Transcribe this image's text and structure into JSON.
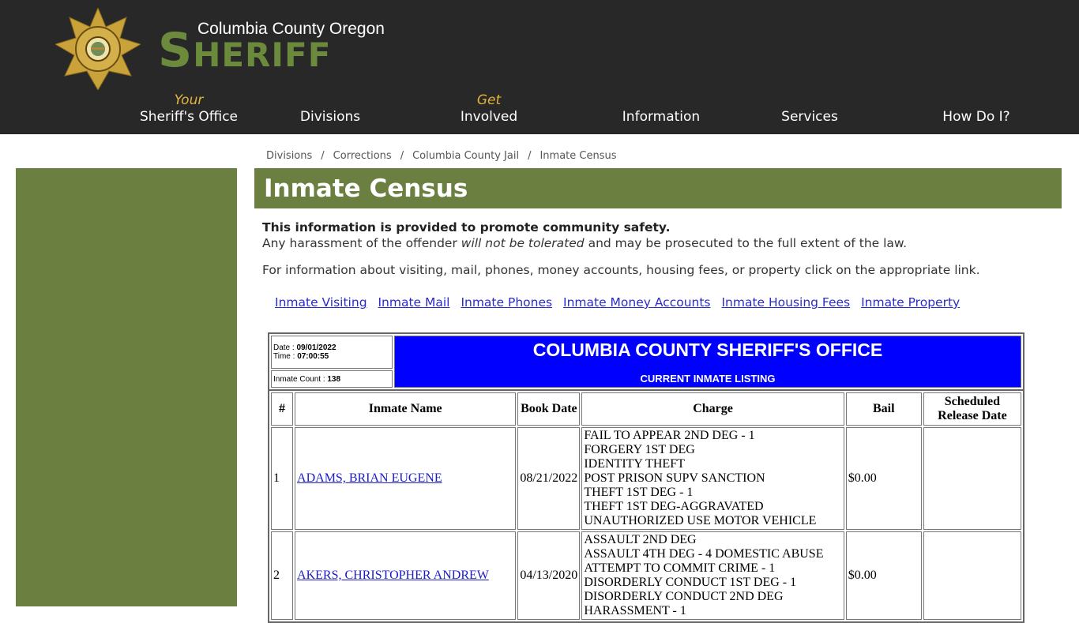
{
  "header": {
    "subtitle": "Columbia County Oregon",
    "title_initial": "S",
    "title_rest": "HERIFF",
    "logo": "sheriff-star-badge-icon",
    "colors": {
      "header_bg": "#282828",
      "brand_green": "#6b8a3c",
      "nav_accent": "#e0b53c"
    }
  },
  "nav": [
    {
      "pre": "Your",
      "label": "Sheriff's Office"
    },
    {
      "pre": "",
      "label": "Divisions"
    },
    {
      "pre": "Get",
      "label": "Involved"
    },
    {
      "pre": "",
      "label": "Information"
    },
    {
      "pre": "",
      "label": "Services"
    },
    {
      "pre": "",
      "label": "How Do I?"
    }
  ],
  "breadcrumb": {
    "items": [
      "Divisions",
      "Corrections",
      "Columbia County Jail",
      "Inmate Census"
    ],
    "separator": "/"
  },
  "page": {
    "title": "Inmate Census",
    "notice_bold": "This information is provided to promote community safety.",
    "notice_pre": "Any harassment of the offender ",
    "notice_em": "will not be tolerated",
    "notice_post": " and may be prosecuted to the full extent of the law.",
    "info": "For information about visiting, mail, phones, money accounts, housing fees, or property click on the appropriate link.",
    "panel_color": "#6b8040"
  },
  "links": [
    "Inmate Visiting",
    "Inmate Mail",
    "Inmate Phones",
    "Inmate Money Accounts",
    "Inmate Housing Fees",
    "Inmate Property"
  ],
  "census": {
    "date_label": "Date : ",
    "date": "09/01/2022",
    "time_label": "Time : ",
    "time": "07:00:55",
    "count_label": "Inmate Count : ",
    "count": "138",
    "office_title": "COLUMBIA COUNTY SHERIFF'S OFFICE",
    "listing_title": "CURRENT INMATE LISTING",
    "banner_color": "#0000ff",
    "columns": [
      "#",
      "Inmate Name",
      "Book Date",
      "Charge",
      "Bail",
      "Scheduled Release Date"
    ],
    "rows": [
      {
        "num": "1",
        "name": "ADAMS, BRIAN EUGENE",
        "book_date": "08/21/2022",
        "charges": [
          "FAIL TO APPEAR 2ND DEG - 1",
          "FORGERY 1ST DEG",
          "IDENTITY THEFT",
          "POST PRISON SUPV SANCTION",
          "THEFT 1ST DEG - 1",
          "THEFT 1ST DEG-AGGRAVATED",
          "UNAUTHORIZED USE MOTOR VEHICLE"
        ],
        "bail": "$0.00",
        "release": ""
      },
      {
        "num": "2",
        "name": "AKERS, CHRISTOPHER ANDREW",
        "book_date": "04/13/2020",
        "charges": [
          "ASSAULT 2ND DEG",
          "ASSAULT 4TH DEG - 4 DOMESTIC ABUSE",
          "ATTEMPT TO COMMIT CRIME - 1",
          "DISORDERLY CONDUCT 1ST DEG - 1",
          "DISORDERLY CONDUCT 2ND DEG",
          "HARASSMENT - 1"
        ],
        "bail": "$0.00",
        "release": ""
      }
    ]
  }
}
